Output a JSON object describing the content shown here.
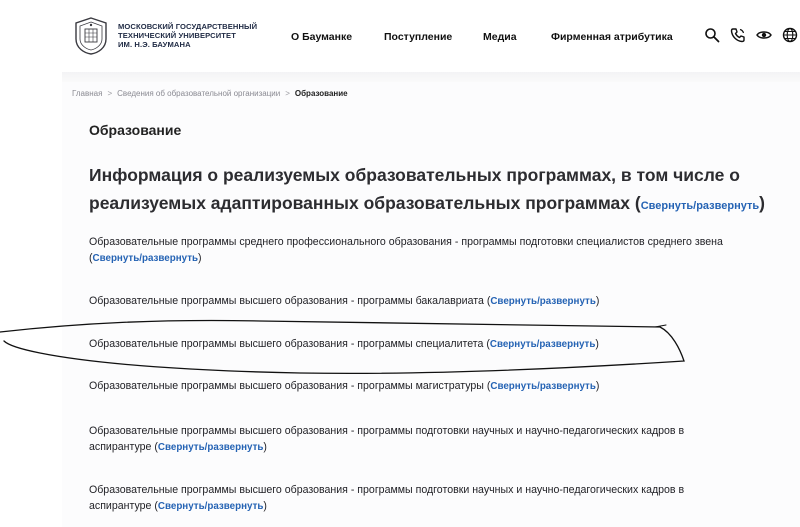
{
  "header": {
    "logo_lines": [
      "МОСКОВСКИЙ ГОСУДАРСТВЕННЫЙ",
      "ТЕХНИЧЕСКИЙ УНИВЕРСИТЕТ",
      "ИМ. Н.Э. БАУМАНА"
    ],
    "nav": [
      "О Бауманке",
      "Поступление",
      "Медиа",
      "Фирменная атрибутика"
    ],
    "tools": [
      "search-icon",
      "phone-icon",
      "eye-icon",
      "globe-icon"
    ]
  },
  "breadcrumb": {
    "items": [
      "Главная",
      "Сведения об образовательной организации",
      "Образование"
    ],
    "separator": ">"
  },
  "page": {
    "title": "Образование",
    "section_title": "Информация о реализуемых образовательных программах, в том числе о реализуемых адаптированных образовательных программах",
    "toggle_label": "Свернуть/развернуть"
  },
  "programs": [
    "Образовательные программы среднего профессионального образования - программы подготовки специалистов среднего звена",
    "Образовательные программы высшего образования - программы бакалавриата",
    "Образовательные программы высшего образования - программы специалитета",
    "Образовательные программы высшего образования - программы магистратуры",
    "Образовательные программы высшего образования - программы подготовки научных и научно-педагогических кадров в аспирантуре",
    "Образовательные программы высшего образования - программы подготовки научных и научно-педагогических кадров в аспирантуре"
  ],
  "colors": {
    "link": "#2563b4",
    "annotation": "#111111"
  }
}
